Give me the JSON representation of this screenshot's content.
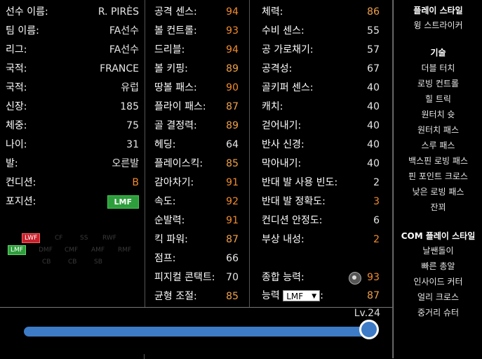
{
  "player_info": [
    {
      "label": "선수 이름:",
      "value": "R. PIRÈS"
    },
    {
      "label": "팀 이름:",
      "value": "FA선수"
    },
    {
      "label": "리그:",
      "value": "FA선수"
    },
    {
      "label": "국적:",
      "value": "FRANCE"
    },
    {
      "label": "국적:",
      "value": "유럽"
    },
    {
      "label": "신장:",
      "value": "185"
    },
    {
      "label": "체중:",
      "value": "75"
    },
    {
      "label": "나이:",
      "value": "31"
    },
    {
      "label": "발:",
      "value": "오른발"
    },
    {
      "label": "컨디션:",
      "value": "B"
    },
    {
      "label": "포지션:",
      "value": "LMF"
    }
  ],
  "position_map": {
    "row1": [
      "LWF",
      "CF",
      "SS",
      "RWF"
    ],
    "row2": [
      "LMF",
      "DMF",
      "CMF",
      "AMF",
      "RMF"
    ],
    "row3": [
      "CB",
      "CB",
      "SB"
    ]
  },
  "stats_left": [
    {
      "label": "공격 센스:",
      "value": "94"
    },
    {
      "label": "볼 컨트롤:",
      "value": "93"
    },
    {
      "label": "드리블:",
      "value": "94"
    },
    {
      "label": "볼 키핑:",
      "value": "89"
    },
    {
      "label": "땅볼 패스:",
      "value": "90"
    },
    {
      "label": "플라이 패스:",
      "value": "87"
    },
    {
      "label": "골 결정력:",
      "value": "89"
    },
    {
      "label": "헤딩:",
      "value": "64"
    },
    {
      "label": "플레이스킥:",
      "value": "85"
    },
    {
      "label": "감아차기:",
      "value": "91"
    },
    {
      "label": "속도:",
      "value": "92"
    },
    {
      "label": "순발력:",
      "value": "91"
    },
    {
      "label": "킥 파워:",
      "value": "87"
    },
    {
      "label": "점프:",
      "value": "66"
    },
    {
      "label": "피지컬 콘택트:",
      "value": "70"
    },
    {
      "label": "균형 조절:",
      "value": "85"
    }
  ],
  "stats_right": [
    {
      "label": "체력:",
      "value": "86"
    },
    {
      "label": "수비 센스:",
      "value": "55"
    },
    {
      "label": "공 가로채기:",
      "value": "57"
    },
    {
      "label": "공격성:",
      "value": "67"
    },
    {
      "label": "골키퍼 센스:",
      "value": "40"
    },
    {
      "label": "캐치:",
      "value": "40"
    },
    {
      "label": "걷어내기:",
      "value": "40"
    },
    {
      "label": "반사 신경:",
      "value": "40"
    },
    {
      "label": "막아내기:",
      "value": "40"
    },
    {
      "label": "반대 발 사용 빈도:",
      "value": "2"
    },
    {
      "label": "반대 발 정확도:",
      "value": "3"
    },
    {
      "label": "컨디션 안정도:",
      "value": "6"
    },
    {
      "label": "부상 내성:",
      "value": "2"
    }
  ],
  "overall": {
    "label": "종합 능력:",
    "value": "93"
  },
  "ability": {
    "label": "능력",
    "selected": "LMF",
    "suffix": ":",
    "value": "87"
  },
  "sidebar": {
    "playstyle_head": "플레이 스타일",
    "playstyle": "윙 스트라이커",
    "skills_head": "기술",
    "skills": [
      "더블 터치",
      "로빙 컨트롤",
      "힐 트릭",
      "원터치 슛",
      "원터치 패스",
      "스루 패스",
      "백스핀 로빙 패스",
      "핀 포인트 크로스",
      "낮은 로빙 패스",
      "잔꾀"
    ],
    "com_head": "COM 플레이 스타일",
    "com": [
      "날쌘돌이",
      "빠른 총알",
      "인사이드 커터",
      "얼리 크로스",
      "중거리 슈터"
    ]
  },
  "level": {
    "label": "Lv.24",
    "fraction": 1.0
  },
  "colors": {
    "orange": "#f28b2c",
    "yellow": "#f0a14a",
    "red": "#e84b3c",
    "accent": "#3d7bc6",
    "green": "#2e9e3c"
  }
}
